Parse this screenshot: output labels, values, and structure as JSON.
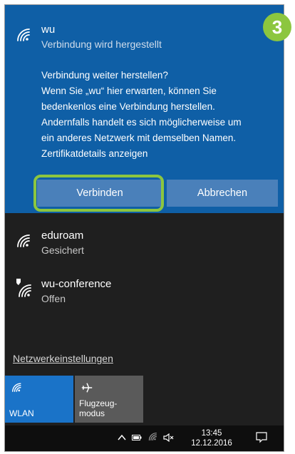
{
  "step_badge": "3",
  "active_network": {
    "name": "wu",
    "status": "Verbindung wird hergestellt",
    "message": "Verbindung weiter herstellen?\nWenn Sie „wu“ hier erwarten, können Sie\nbedenkenlos eine Verbindung herstellen.\nAndernfalls handelt es sich möglicherweise um\nein anderes Netzwerk mit demselben Namen.\nZertifikatdetails anzeigen",
    "connect_label": "Verbinden",
    "cancel_label": "Abbrechen"
  },
  "networks": [
    {
      "name": "eduroam",
      "status": "Gesichert",
      "icon": "wifi-icon"
    },
    {
      "name": "wu-conference",
      "status": "Offen",
      "icon": "wifi-shield-icon"
    }
  ],
  "settings_link": "Netzwerkeinstellungen",
  "tiles": [
    {
      "label": "WLAN",
      "icon": "wifi-icon",
      "active": true
    },
    {
      "label": "Flugzeug-\nmodus",
      "icon": "airplane-icon",
      "active": false
    }
  ],
  "taskbar": {
    "time": "13:45",
    "date": "12.12.2016"
  },
  "colors": {
    "accent": "#0f5fa6",
    "button": "#4a80ba",
    "highlight": "#8cc63f",
    "flyout_bg": "#1f1f1f"
  }
}
